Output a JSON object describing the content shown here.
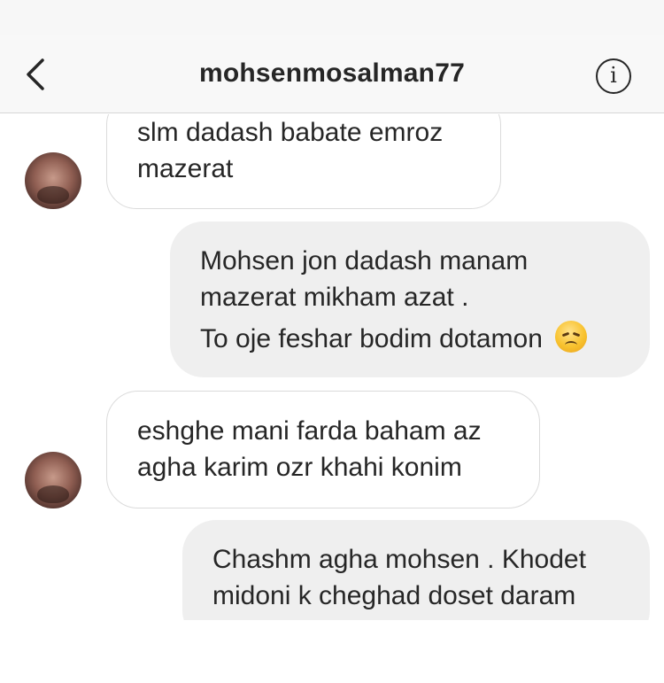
{
  "header": {
    "username": "mohsenmosalman77",
    "back_icon": "chevron-left-icon",
    "info_icon": "info-circle-icon",
    "info_glyph": "i"
  },
  "messages": [
    {
      "direction": "incoming",
      "lines": [
        "slm dadash babate emroz",
        "mazerat"
      ]
    },
    {
      "direction": "outgoing",
      "lines": [
        "Mohsen jon dadash manam",
        "mazerat mikham azat .",
        "To oje feshar bodim dotamon"
      ],
      "emoji": "disappointed-face-emoji"
    },
    {
      "direction": "incoming",
      "lines": [
        "eshghe mani farda baham az",
        "agha karim ozr khahi konim"
      ]
    },
    {
      "direction": "outgoing",
      "lines": [
        "Chashm agha mohsen . Khodet",
        "midoni k cheghad doset daram"
      ]
    }
  ],
  "colors": {
    "header_bg": "#f8f8f8",
    "incoming_bubble_bg": "#ffffff",
    "incoming_bubble_border": "#dbdbdb",
    "outgoing_bubble_bg": "#efefef",
    "text": "#262626"
  }
}
